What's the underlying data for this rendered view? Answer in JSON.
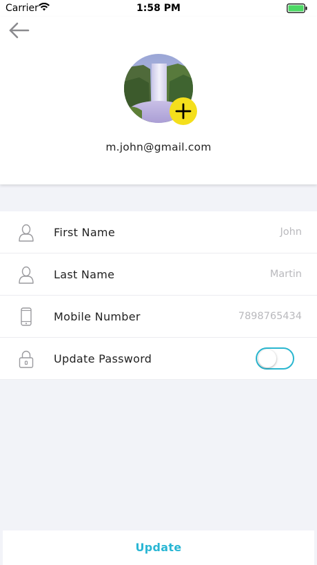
{
  "status_bar": {
    "carrier": "Carrier",
    "time": "1:58 PM",
    "wifi_icon": "wifi-icon",
    "battery_icon": "battery-icon",
    "battery_color": "#4cd964"
  },
  "header": {
    "back_icon": "arrow-left-icon",
    "avatar": "avatar",
    "add_photo_icon": "plus-icon",
    "email": "m.john@gmail.com"
  },
  "form": {
    "rows": [
      {
        "icon": "user-icon",
        "label": "First Name",
        "value": "John"
      },
      {
        "icon": "user-icon",
        "label": "Last Name",
        "value": "Martin"
      },
      {
        "icon": "mobile-phone-icon",
        "label": "Mobile Number",
        "value": "7898765434"
      },
      {
        "icon": "lock-icon",
        "label": "Update Password",
        "toggle_on": false
      }
    ]
  },
  "actions": {
    "update_label": "Update"
  },
  "colors": {
    "accent": "#29b6d4",
    "add_button": "#f4df1c",
    "background": "#f2f3f8",
    "placeholder_text": "#b9b9bd"
  }
}
